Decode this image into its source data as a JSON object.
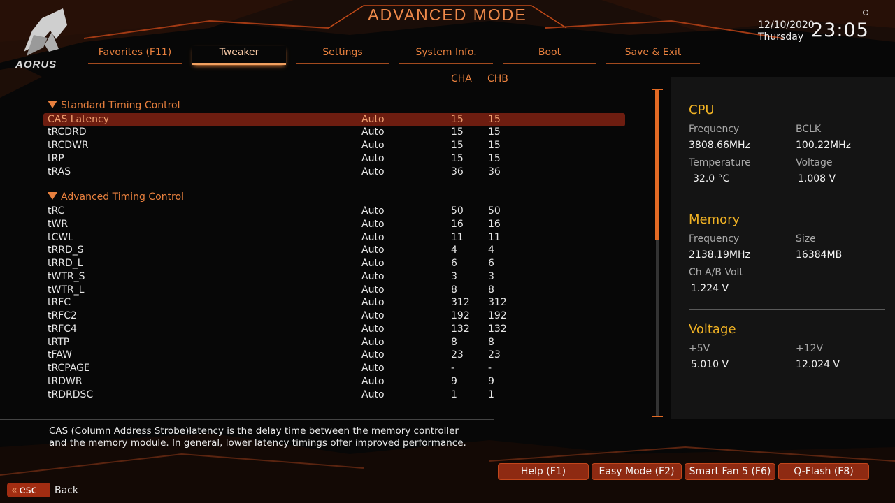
{
  "header": {
    "title": "ADVANCED MODE",
    "logo_text": "AORUS",
    "date": "12/10/2020",
    "day": "Thursday",
    "time": "23:05"
  },
  "tabs": [
    {
      "label": "Favorites (F11)",
      "active": false
    },
    {
      "label": "Tweaker",
      "active": true
    },
    {
      "label": "Settings",
      "active": false
    },
    {
      "label": "System Info.",
      "active": false
    },
    {
      "label": "Boot",
      "active": false
    },
    {
      "label": "Save & Exit",
      "active": false
    }
  ],
  "columns": {
    "cha": "CHA",
    "chb": "CHB"
  },
  "sections": {
    "standard": "Standard Timing Control",
    "advanced": "Advanced Timing Control"
  },
  "rows": [
    {
      "name": "CAS Latency",
      "value": "Auto",
      "cha": "15",
      "chb": "15"
    },
    {
      "name": "tRCDRD",
      "value": "Auto",
      "cha": "15",
      "chb": "15"
    },
    {
      "name": "tRCDWR",
      "value": "Auto",
      "cha": "15",
      "chb": "15"
    },
    {
      "name": "tRP",
      "value": "Auto",
      "cha": "15",
      "chb": "15"
    },
    {
      "name": "tRAS",
      "value": "Auto",
      "cha": "36",
      "chb": "36"
    },
    {
      "name": "tRC",
      "value": "Auto",
      "cha": "50",
      "chb": "50"
    },
    {
      "name": "tWR",
      "value": "Auto",
      "cha": "16",
      "chb": "16"
    },
    {
      "name": "tCWL",
      "value": "Auto",
      "cha": "11",
      "chb": "11"
    },
    {
      "name": "tRRD_S",
      "value": "Auto",
      "cha": "4",
      "chb": "4"
    },
    {
      "name": "tRRD_L",
      "value": "Auto",
      "cha": "6",
      "chb": "6"
    },
    {
      "name": "tWTR_S",
      "value": "Auto",
      "cha": "3",
      "chb": "3"
    },
    {
      "name": "tWTR_L",
      "value": "Auto",
      "cha": "8",
      "chb": "8"
    },
    {
      "name": "tRFC",
      "value": "Auto",
      "cha": "312",
      "chb": "312"
    },
    {
      "name": "tRFC2",
      "value": "Auto",
      "cha": "192",
      "chb": "192"
    },
    {
      "name": "tRFC4",
      "value": "Auto",
      "cha": "132",
      "chb": "132"
    },
    {
      "name": "tRTP",
      "value": "Auto",
      "cha": "8",
      "chb": "8"
    },
    {
      "name": "tFAW",
      "value": "Auto",
      "cha": "23",
      "chb": "23"
    },
    {
      "name": "tRCPAGE",
      "value": "Auto",
      "cha": "-",
      "chb": "-"
    },
    {
      "name": "tRDWR",
      "value": "Auto",
      "cha": "9",
      "chb": "9"
    },
    {
      "name": "tRDRDSC",
      "value": "Auto",
      "cha": "1",
      "chb": "1"
    }
  ],
  "description": {
    "line1": "CAS (Column Address Strobe)latency is the delay time between the memory controller",
    "line2": "and the memory module. In general, lower latency timings offer improved performance."
  },
  "panel": {
    "cpu": {
      "title": "CPU",
      "freq_label": "Frequency",
      "freq": "3808.66MHz",
      "bclk_label": "BCLK",
      "bclk": "100.22MHz",
      "temp_label": "Temperature",
      "temp": "32.0 °C",
      "volt_label": "Voltage",
      "volt": "1.008 V"
    },
    "memory": {
      "title": "Memory",
      "freq_label": "Frequency",
      "freq": "2138.19MHz",
      "size_label": "Size",
      "size": "16384MB",
      "volt_label": "Ch A/B Volt",
      "volt": "1.224 V"
    },
    "voltage": {
      "title": "Voltage",
      "v5_label": "+5V",
      "v5": "5.010 V",
      "v12_label": "+12V",
      "v12": "12.024 V"
    }
  },
  "buttons": {
    "help": "Help (F1)",
    "easy": "Easy Mode (F2)",
    "smartfan": "Smart Fan 5 (F6)",
    "qflash": "Q-Flash (F8)",
    "esc": "esc",
    "back": "Back"
  },
  "scroll_position": 0,
  "colors": {
    "accent": "#e8803e",
    "highlight": "#6d1d10",
    "panel_head": "#f0b224"
  }
}
